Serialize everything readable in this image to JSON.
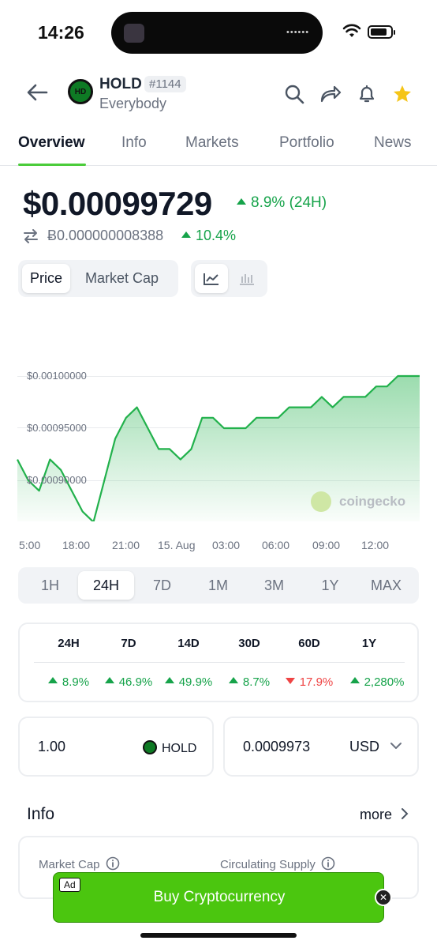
{
  "status_bar": {
    "time": "14:26"
  },
  "header": {
    "symbol": "HOLD",
    "rank": "#1144",
    "name": "Everybody",
    "star_color": "#f5c518"
  },
  "tabs": [
    {
      "label": "Overview"
    },
    {
      "label": "Info"
    },
    {
      "label": "Markets"
    },
    {
      "label": "Portfolio"
    },
    {
      "label": "News"
    }
  ],
  "price": {
    "usd": "$0.00099729",
    "change_24h": "8.9% (24H)",
    "btc": "Ƀ0.000000008388",
    "btc_change": "10.4%"
  },
  "toggles": {
    "price": "Price",
    "market_cap": "Market Cap"
  },
  "chart_data": {
    "type": "area",
    "y_ticks": [
      "$0.00100000",
      "$0.00095000",
      "$0.00090000"
    ],
    "x_ticks": [
      "5:00",
      "18:00",
      "21:00",
      "15. Aug",
      "03:00",
      "06:00",
      "09:00",
      "12:00"
    ],
    "color": "#22b14c",
    "ylim": [
      0.00085,
      0.00102
    ],
    "values": [
      0.00092,
      0.0009,
      0.00089,
      0.00092,
      0.00091,
      0.00089,
      0.00087,
      0.00086,
      0.0009,
      0.00094,
      0.00096,
      0.00097,
      0.00095,
      0.00093,
      0.00093,
      0.00092,
      0.00093,
      0.00096,
      0.00096,
      0.00095,
      0.00095,
      0.00095,
      0.00096,
      0.00096,
      0.00096,
      0.00097,
      0.00097,
      0.00097,
      0.00098,
      0.00097,
      0.00098,
      0.00098,
      0.00098,
      0.00099,
      0.00099,
      0.001,
      0.001,
      0.001
    ],
    "watermark": "coingecko"
  },
  "ranges": [
    "1H",
    "24H",
    "7D",
    "1M",
    "3M",
    "1Y",
    "MAX"
  ],
  "performance": {
    "headers": [
      "24H",
      "7D",
      "14D",
      "30D",
      "60D",
      "1Y"
    ],
    "values": [
      {
        "text": "8.9%",
        "dir": "up"
      },
      {
        "text": "46.9%",
        "dir": "up"
      },
      {
        "text": "49.9%",
        "dir": "up"
      },
      {
        "text": "8.7%",
        "dir": "up"
      },
      {
        "text": "17.9%",
        "dir": "down"
      },
      {
        "text": "2,280%",
        "dir": "up"
      }
    ]
  },
  "converter": {
    "amount": "1.00",
    "coin": "HOLD",
    "fiat_value": "0.0009973",
    "fiat": "USD"
  },
  "info": {
    "title": "Info",
    "more": "more",
    "labels": [
      "Market Cap",
      "Circulating Supply"
    ]
  },
  "ad": {
    "tag": "Ad",
    "label": "Buy Cryptocurrency"
  }
}
